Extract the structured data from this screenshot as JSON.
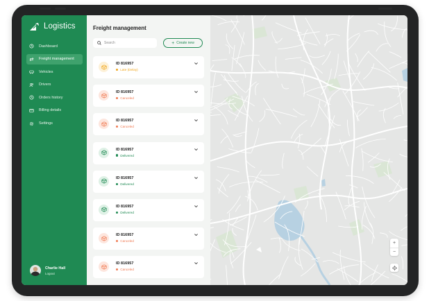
{
  "app": {
    "name": "Logistics"
  },
  "sidebar": {
    "items": [
      {
        "label": "Dashboard",
        "icon": "dashboard-icon",
        "active": false
      },
      {
        "label": "Freight management",
        "icon": "transfer-icon",
        "active": true
      },
      {
        "label": "Vehicles",
        "icon": "vehicle-icon",
        "active": false
      },
      {
        "label": "Drivers",
        "icon": "drivers-icon",
        "active": false
      },
      {
        "label": "Orders history",
        "icon": "clock-icon",
        "active": false
      },
      {
        "label": "Billing details",
        "icon": "card-icon",
        "active": false
      },
      {
        "label": "Settings",
        "icon": "gear-icon",
        "active": false
      }
    ],
    "user": {
      "name": "Charlie Hall",
      "action": "Logout"
    }
  },
  "freight": {
    "title": "Freight management",
    "search_placeholder": "Search",
    "create_label": "Create new",
    "orders": [
      {
        "id": "ID 816957",
        "status": "Late (Delay)",
        "kind": "late"
      },
      {
        "id": "ID 816957",
        "status": "Canceled",
        "kind": "canceled"
      },
      {
        "id": "ID 816957",
        "status": "Canceled",
        "kind": "canceled"
      },
      {
        "id": "ID 816957",
        "status": "Delivered",
        "kind": "delivered"
      },
      {
        "id": "ID 816957",
        "status": "Delivered",
        "kind": "delivered"
      },
      {
        "id": "ID 816957",
        "status": "Delivered",
        "kind": "delivered"
      },
      {
        "id": "ID 816957",
        "status": "Canceled",
        "kind": "canceled"
      },
      {
        "id": "ID 816957",
        "status": "Canceled",
        "kind": "canceled"
      }
    ]
  },
  "map": {
    "zoom_in": "+",
    "zoom_out": "−"
  },
  "colors": {
    "brand": "#1f8a53",
    "late": "#f0a61c",
    "canceled": "#f07a52",
    "delivered": "#1f8a53",
    "late_bg": "#fdf1d8",
    "canceled_bg": "#fde6de",
    "delivered_bg": "#dff1e6",
    "water": "#b7d1e2",
    "park": "#d5e6cf"
  }
}
